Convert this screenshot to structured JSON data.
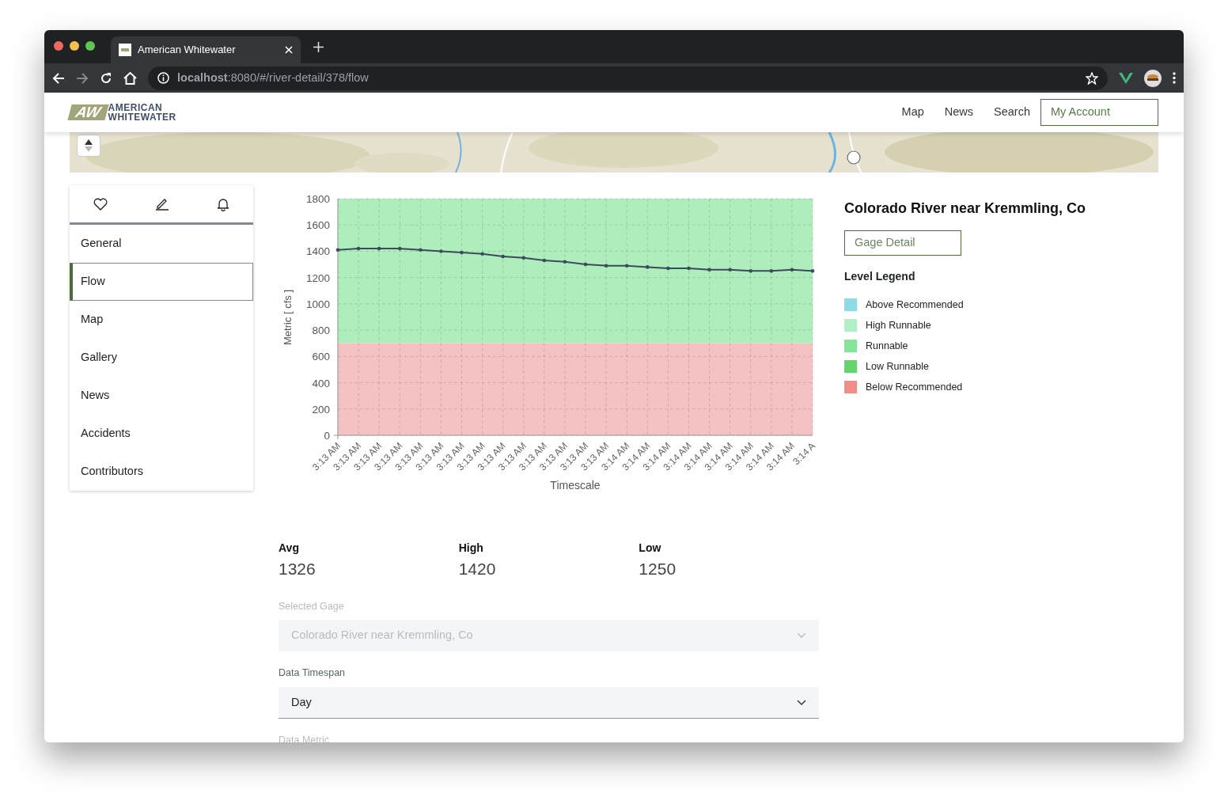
{
  "browser": {
    "tab_title": "American Whitewater",
    "url": "**localhost**:8080/#/river-detail/378/flow"
  },
  "navbar": {
    "logo": {
      "mark": "AW",
      "lines": [
        "AMERICAN",
        "WHITEWATER"
      ]
    },
    "links": [
      "Map",
      "News",
      "Search"
    ],
    "account_button": "My Account"
  },
  "sidebar": {
    "items": [
      {
        "label": "General",
        "selected": false
      },
      {
        "label": "Flow",
        "selected": true
      },
      {
        "label": "Map",
        "selected": false
      },
      {
        "label": "Gallery",
        "selected": false
      },
      {
        "label": "News",
        "selected": false
      },
      {
        "label": "Accidents",
        "selected": false
      },
      {
        "label": "Contributors",
        "selected": false
      }
    ]
  },
  "flow_chart": {
    "chart_data": {
      "type": "line",
      "xlabel": "Timescale",
      "ylabel": "Metric [ cfs ]",
      "categories": [
        "3:13 AM",
        "3:13 AM",
        "3:13 AM",
        "3:13 AM",
        "3:13 AM",
        "3:13 AM",
        "3:13 AM",
        "3:13 AM",
        "3:13 AM",
        "3:13 AM",
        "3:13 AM",
        "3:13 AM",
        "3:13 AM",
        "3:13 AM",
        "3:14 AM",
        "3:14 AM",
        "3:14 AM",
        "3:14 AM",
        "3:14 AM",
        "3:14 AM",
        "3:14 AM",
        "3:14 AM",
        "3:14 AM",
        "3:14 A"
      ],
      "series": [
        {
          "color": "#3d4a5c",
          "values": [
            1410,
            1420,
            1420,
            1420,
            1410,
            1400,
            1390,
            1380,
            1360,
            1350,
            1330,
            1320,
            1300,
            1290,
            1290,
            1280,
            1270,
            1270,
            1260,
            1260,
            1250,
            1250,
            1260,
            1250
          ]
        }
      ],
      "ylim": [
        0,
        1800
      ],
      "yticks": [
        0,
        200,
        400,
        600,
        800,
        1000,
        1200,
        1400,
        1600,
        1800
      ],
      "grid": true,
      "bands": [
        {
          "axis": "y",
          "from": 0,
          "to": 700,
          "color": "#f4c2c2"
        },
        {
          "axis": "y",
          "from": 700,
          "to": 1800,
          "color": "#aeeebc"
        }
      ]
    }
  },
  "gage": {
    "title": "Colorado River near Kremmling, Co",
    "detail_button": "Gage Detail",
    "legend_title": "Level Legend",
    "legend": [
      {
        "label": "Above Recommended",
        "color": "#8ddbe6"
      },
      {
        "label": "High Runnable",
        "color": "#b0f0c4"
      },
      {
        "label": "Runnable",
        "color": "#86e39a"
      },
      {
        "label": "Low Runnable",
        "color": "#63d46e"
      },
      {
        "label": "Below Recommended",
        "color": "#f08f8a"
      }
    ]
  },
  "stats": [
    {
      "label": "Avg",
      "value": "1326"
    },
    {
      "label": "High",
      "value": "1420"
    },
    {
      "label": "Low",
      "value": "1250"
    }
  ],
  "fields": [
    {
      "label": "Selected Gage",
      "value": "Colorado River near Kremmling, Co",
      "disabled": true
    },
    {
      "label": "Data Timespan",
      "value": "Day",
      "disabled": false
    },
    {
      "label": "Data Metric",
      "disabled": true
    }
  ]
}
